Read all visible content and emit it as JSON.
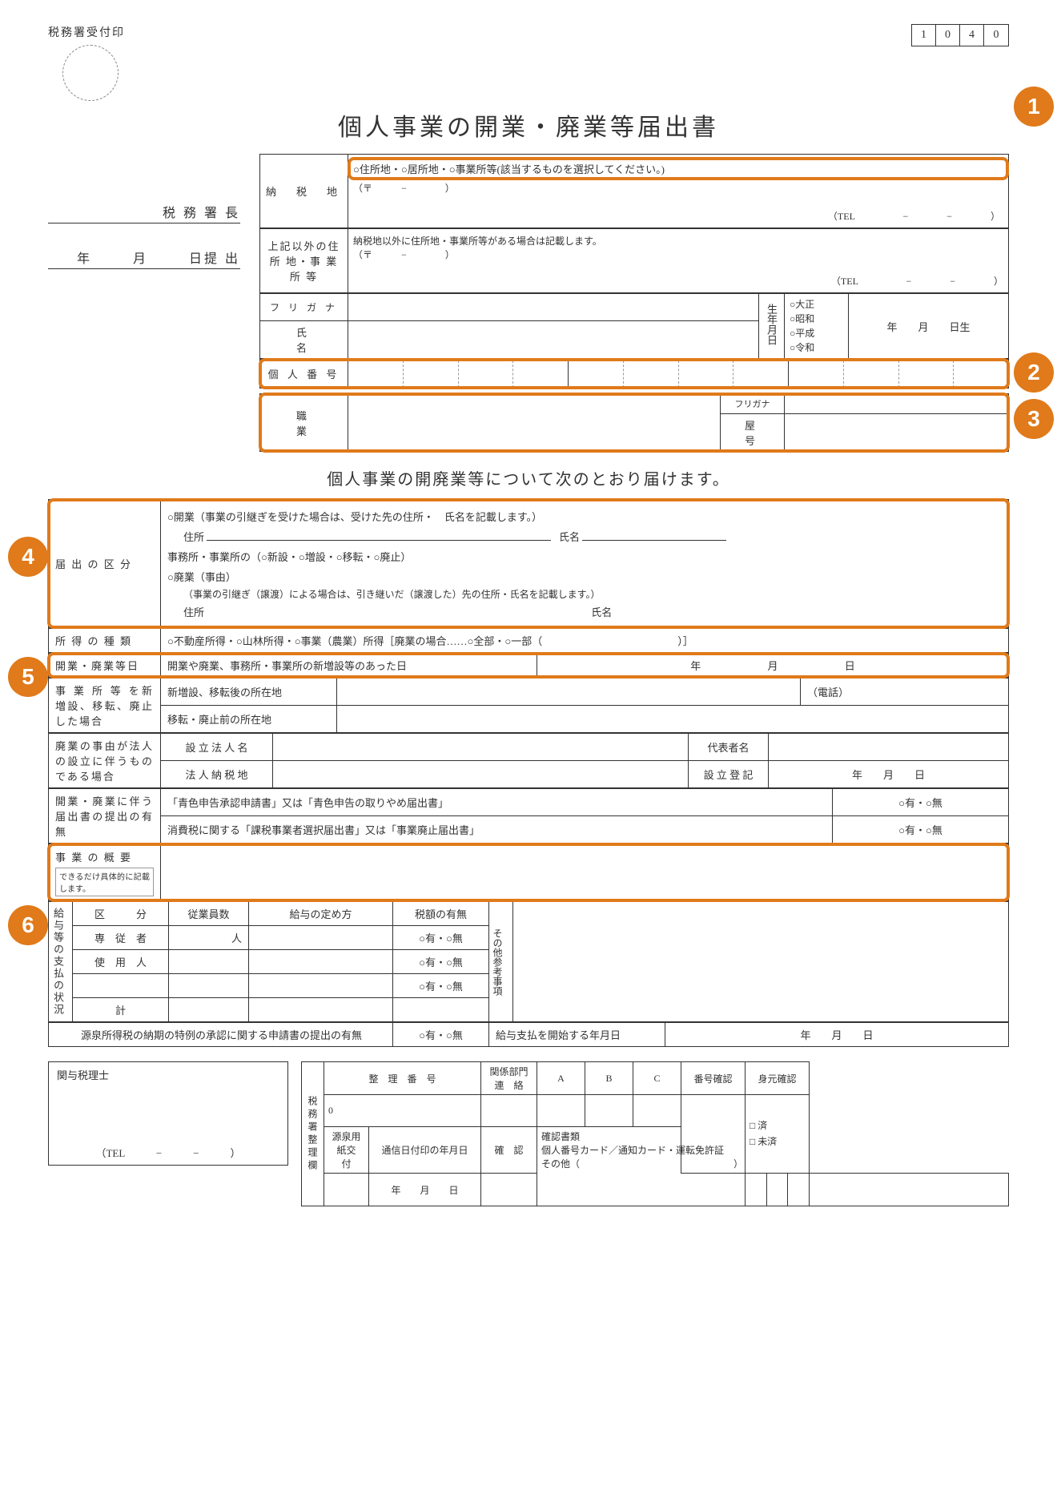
{
  "form_code": [
    "1",
    "0",
    "4",
    "0"
  ],
  "header": {
    "stamp_label": "税務署受付印",
    "title": "個人事業の開業・廃業等届出書"
  },
  "left": {
    "tax_office_line": "税 務 署 長",
    "year": "年",
    "month": "月",
    "day": "日提 出"
  },
  "taxpayer": {
    "nouzei_lbl": "納　税　地",
    "nouzei_choice": "○住所地・○居所地・○事業所等(該当するものを選択してください。)",
    "postal_mark": "（〒　　　−　　　　）",
    "tel_fmt": "（TEL　　　　　−　　　　−　　　　）",
    "other_addr_lbl": "上記以外の住 所 地・事 業 所 等",
    "other_addr_note": "納税地以外に住所地・事業所等がある場合は記載します。",
    "other_postal": "（〒　　　−　　　　）",
    "other_tel": "（TEL　　　　　−　　　　−　　　　）",
    "furigana_lbl": "フ リ ガ ナ",
    "name_lbl": "氏　　　　名",
    "birth_lbl": "生年月日",
    "eras": [
      "○大正",
      "○昭和",
      "○平成",
      "○令和"
    ],
    "birth_suffix": "年　　月　　日生",
    "mynumber_lbl": "個 人 番 号",
    "occupation_lbl": "職　　　　業",
    "yagou_furi_lbl": "フリガナ",
    "yagou_lbl": "屋　　号"
  },
  "subheading": "個人事業の開廃業等について次のとおり届けます。",
  "notification": {
    "section_lbl": "届 出 の 区 分",
    "open_line": "○開業（事業の引継ぎを受けた場合は、受けた先の住所・　氏名を記載します。）",
    "addr_label": "住所",
    "name_label": "氏名",
    "office_line": "事務所・事業所の（○新設・○増設・○移転・○廃止）",
    "close_line": "○廃業（事由）",
    "close_note": "（事業の引継ぎ（譲渡）による場合は、引き継いだ（譲渡した）先の住所・氏名を記載します。）"
  },
  "income": {
    "lbl": "所 得 の 種 類",
    "text": "○不動産所得・○山林所得・○事業（農業）所得［廃業の場合……○全部・○一部（　　　　　　　　　　　　　）］"
  },
  "open_close_date": {
    "lbl": "開業・廃業等日",
    "text": "開業や廃業、事務所・事業所の新増設等のあった日",
    "y": "年",
    "m": "月",
    "d": "日"
  },
  "new_office": {
    "lbl": "事 業 所 等 を新増設、移転、廃止した場合",
    "row1": "新増設、移転後の所在地",
    "tel": "（電話）",
    "row2": "移転・廃止前の所在地"
  },
  "corp": {
    "lbl": "廃業の事由が法人の設立に伴うものである場合",
    "r1a": "設 立 法 人 名",
    "r1b": "代表者名",
    "r2a": "法 人 納 税 地",
    "r2b": "設 立 登 記",
    "r2c": "年　　月　　日"
  },
  "attached": {
    "lbl": "開業・廃業に伴う届出書の提出の有無",
    "row1": "「青色申告承認申請書」又は「青色申告の取りやめ届出書」",
    "row2": "消費税に関する「課税事業者選択届出書」又は「事業廃止届出書」",
    "yn": "○有・○無"
  },
  "summary": {
    "lbl": "事 業 の 概 要",
    "note": "できるだけ具体的に記載します。"
  },
  "salary": {
    "vlabel": "給与等の支払の状況",
    "hdr": [
      "区　　　分",
      "従業員数",
      "給与の定め方",
      "税額の有無"
    ],
    "rows": [
      "専　従　者",
      "使　用　人",
      "",
      "計"
    ],
    "unit": "人",
    "yn": "○有・○無",
    "other_lbl": "その他参考事項",
    "withhold_lbl": "源泉所得税の納期の特例の承認に関する申請書の提出の有無",
    "start_lbl": "給与支払を開始する年月日",
    "start_date": "年　　月　　日"
  },
  "advisor": {
    "lbl": "関与税理士",
    "tel": "（TEL　　　−　　　−　　　）"
  },
  "office_use": {
    "vlabel": "税務署整理欄",
    "seiri": "整　理　番　号",
    "dept": "関係部門連　絡",
    "abc": [
      "A",
      "B",
      "C"
    ],
    "num_check": "番号確認",
    "id_check": "身元確認",
    "done": "□ 済",
    "not_done": "□ 未済",
    "gensen": "源泉用紙交　付",
    "tsushin": "通信日付印の年月日",
    "kakunin": "確　認",
    "docs_lbl": "確認書類",
    "docs_text": "個人番号カード／通知カード・運転免許証",
    "other_doc": "その他（　　　　　　　　　　　　　　　　）",
    "ymd": "年　　月　　日"
  },
  "badges": [
    "1",
    "2",
    "3",
    "4",
    "5",
    "6"
  ]
}
